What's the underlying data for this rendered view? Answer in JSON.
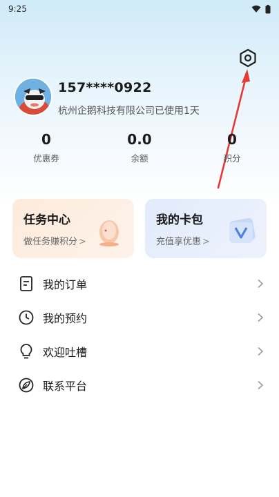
{
  "status": {
    "time": "9:25"
  },
  "profile": {
    "phone": "157****0922",
    "usage": "杭州企鹅科技有限公司已使用1天"
  },
  "stats": [
    {
      "value": "0",
      "label": "优惠券"
    },
    {
      "value": "0.0",
      "label": "余额"
    },
    {
      "value": "0",
      "label": "积分"
    }
  ],
  "cards": {
    "task": {
      "title": "任务中心",
      "subtitle": "做任务赚积分",
      "chevron": ">"
    },
    "wallet": {
      "title": "我的卡包",
      "subtitle": "充值享优惠",
      "chevron": ">"
    }
  },
  "menu": [
    {
      "label": "我的订单",
      "icon": "document-icon"
    },
    {
      "label": "我的预约",
      "icon": "clock-icon"
    },
    {
      "label": "欢迎吐槽",
      "icon": "lightbulb-icon"
    },
    {
      "label": "联系平台",
      "icon": "leaf-icon"
    }
  ],
  "colors": {
    "annotation_arrow": "#e53935",
    "task_card_bg": "#fdebdc",
    "wallet_card_bg": "#e2ebfb"
  }
}
